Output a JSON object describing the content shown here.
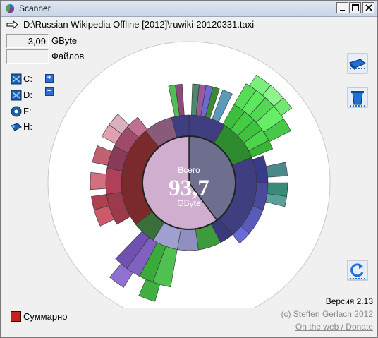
{
  "window": {
    "title": "Scanner"
  },
  "path": {
    "text": "D:\\Russian Wikipedia Offline [2012]\\ruwiki-20120331.taxi"
  },
  "stats": {
    "size_value": "3,09",
    "size_unit": "GByte",
    "files_value": "",
    "files_label": "Файлов"
  },
  "drives": [
    {
      "label": "C:",
      "icon": "network-drive-icon"
    },
    {
      "label": "D:",
      "icon": "network-drive-icon"
    },
    {
      "label": "F:",
      "icon": "cd-drive-icon"
    },
    {
      "label": "H:",
      "icon": "usb-drive-icon"
    }
  ],
  "expand_buttons": {
    "plus": "+",
    "minus": "−"
  },
  "center": {
    "label_top": "Всего",
    "value": "93,7",
    "label_bottom": "GByte"
  },
  "summary": {
    "label": "Суммарно",
    "color": "#c81e1e"
  },
  "footer": {
    "version": "Версия 2.13",
    "copyright": "(c) Steffen Gerlach 2012",
    "link": "On the web / Donate"
  },
  "colors": {
    "disk_bg": "#ffffff",
    "center_fill": "#6e6e8e",
    "accent": "#2b6fcf"
  }
}
